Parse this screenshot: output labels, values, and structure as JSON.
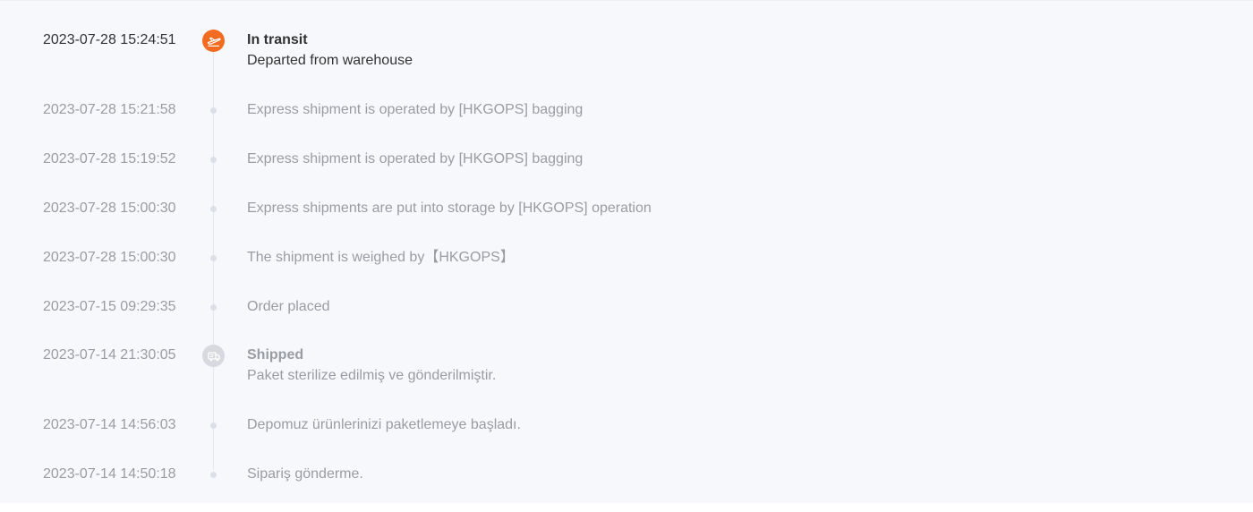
{
  "colors": {
    "accent": "#f26b21",
    "muted_text": "#9a9ca3",
    "active_text": "#333333",
    "rail": "#e4e6ec",
    "background": "#f7f8fc"
  },
  "events": [
    {
      "time": "2023-07-28 15:24:51",
      "status": "In transit",
      "desc": "Departed from warehouse",
      "icon": "plane-icon"
    },
    {
      "time": "2023-07-28 15:21:58",
      "status": "",
      "desc": "Express shipment is operated by [HKGOPS] bagging",
      "icon": ""
    },
    {
      "time": "2023-07-28 15:19:52",
      "status": "",
      "desc": "Express shipment is operated by [HKGOPS] bagging",
      "icon": ""
    },
    {
      "time": "2023-07-28 15:00:30",
      "status": "",
      "desc": "Express shipments are put into storage by [HKGOPS] operation",
      "icon": ""
    },
    {
      "time": "2023-07-28 15:00:30",
      "status": "",
      "desc": "The shipment is weighed by【HKGOPS】",
      "icon": ""
    },
    {
      "time": "2023-07-15 09:29:35",
      "status": "",
      "desc": "Order placed",
      "icon": ""
    },
    {
      "time": "2023-07-14 21:30:05",
      "status": "Shipped",
      "desc": "Paket sterilize edilmiş ve gönderilmiştir.",
      "icon": "truck-icon"
    },
    {
      "time": "2023-07-14 14:56:03",
      "status": "",
      "desc": "Depomuz ürünlerinizi paketlemeye başladı.",
      "icon": ""
    },
    {
      "time": "2023-07-14 14:50:18",
      "status": "",
      "desc": "Sipariş gönderme.",
      "icon": ""
    }
  ]
}
